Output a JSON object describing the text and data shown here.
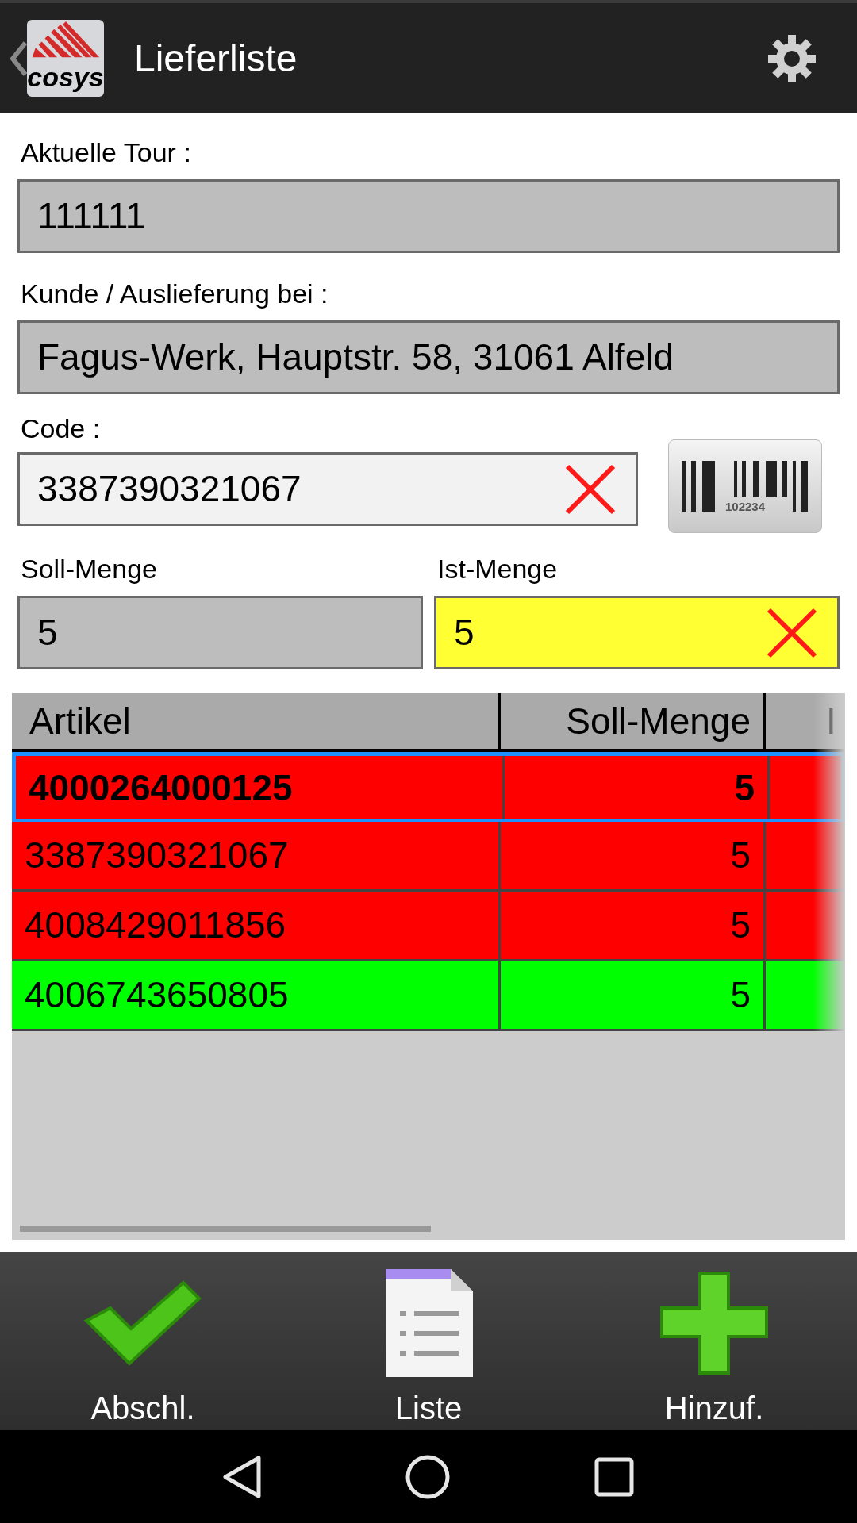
{
  "app_bar": {
    "title": "Lieferliste",
    "logo_text": "cosys"
  },
  "form": {
    "tour_label": "Aktuelle Tour :",
    "tour_value": "111111",
    "customer_label": "Kunde / Auslieferung bei :",
    "customer_value": "Fagus-Werk, Hauptstr. 58, 31061 Alfeld",
    "code_label": "Code :",
    "code_value": "3387390321067",
    "barcode_number": "102234",
    "target_label": "Soll-Menge",
    "target_value": "5",
    "actual_label": "Ist-Menge",
    "actual_value": "5"
  },
  "table": {
    "columns": [
      "Artikel",
      "Soll-Menge",
      "I"
    ],
    "rows": [
      {
        "article": "4000264000125",
        "target": "5",
        "color": "#ff0000",
        "selected": true
      },
      {
        "article": "3387390321067",
        "target": "5",
        "color": "#ff0000",
        "selected": false
      },
      {
        "article": "4008429011856",
        "target": "5",
        "color": "#ff0000",
        "selected": false
      },
      {
        "article": "4006743650805",
        "target": "5",
        "color": "#00ff00",
        "selected": false
      }
    ]
  },
  "toolbar": [
    {
      "kind": "check",
      "label": "Abschl."
    },
    {
      "kind": "list",
      "label": "Liste"
    },
    {
      "kind": "add",
      "label": "Hinzuf."
    }
  ]
}
